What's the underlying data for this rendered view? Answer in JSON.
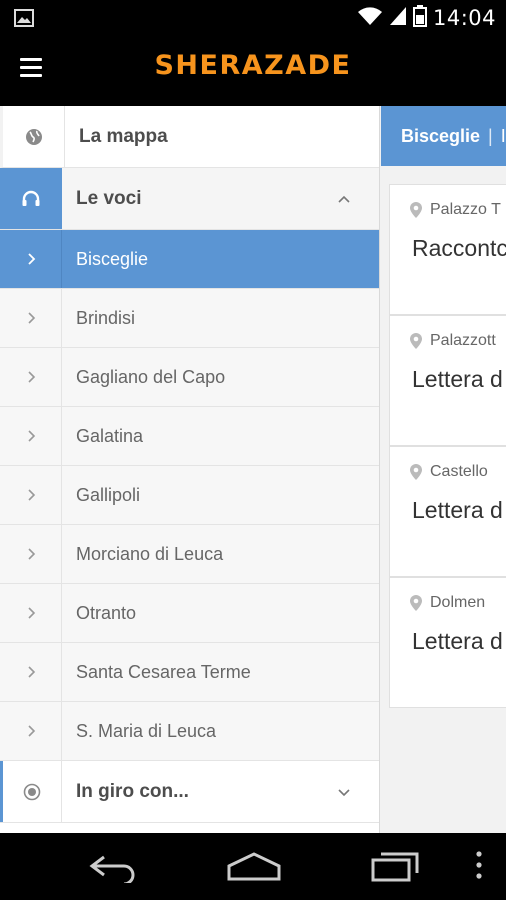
{
  "status_bar": {
    "time": "14:04"
  },
  "app_bar": {
    "brand": "SHERAZADE"
  },
  "drawer": {
    "sections": [
      {
        "label": "La mappa",
        "icon": "globe-icon"
      },
      {
        "label": "Le voci",
        "icon": "headphones-icon",
        "expanded": true
      },
      {
        "label": "In giro con...",
        "icon": "target-icon",
        "expanded": false
      }
    ],
    "items": [
      {
        "label": "Bisceglie",
        "active": true
      },
      {
        "label": "Brindisi"
      },
      {
        "label": "Gagliano del Capo"
      },
      {
        "label": "Galatina"
      },
      {
        "label": "Gallipoli"
      },
      {
        "label": "Morciano di Leuca"
      },
      {
        "label": "Otranto"
      },
      {
        "label": "Santa Cesarea Terme"
      },
      {
        "label": "S. Maria di Leuca"
      }
    ]
  },
  "panel": {
    "tab_active": "Bisceglie",
    "tab_separator": "|",
    "tab_next": "I",
    "cards": [
      {
        "place": "Palazzo T",
        "title": "Raccontc"
      },
      {
        "place": "Palazzott",
        "title": "Lettera d"
      },
      {
        "place": "Castello",
        "title": "Lettera d"
      },
      {
        "place": "Dolmen",
        "title": "Lettera d"
      }
    ]
  },
  "colors": {
    "accent": "#5b95d3",
    "brand": "#f7941d",
    "bar_bg": "#000000"
  }
}
